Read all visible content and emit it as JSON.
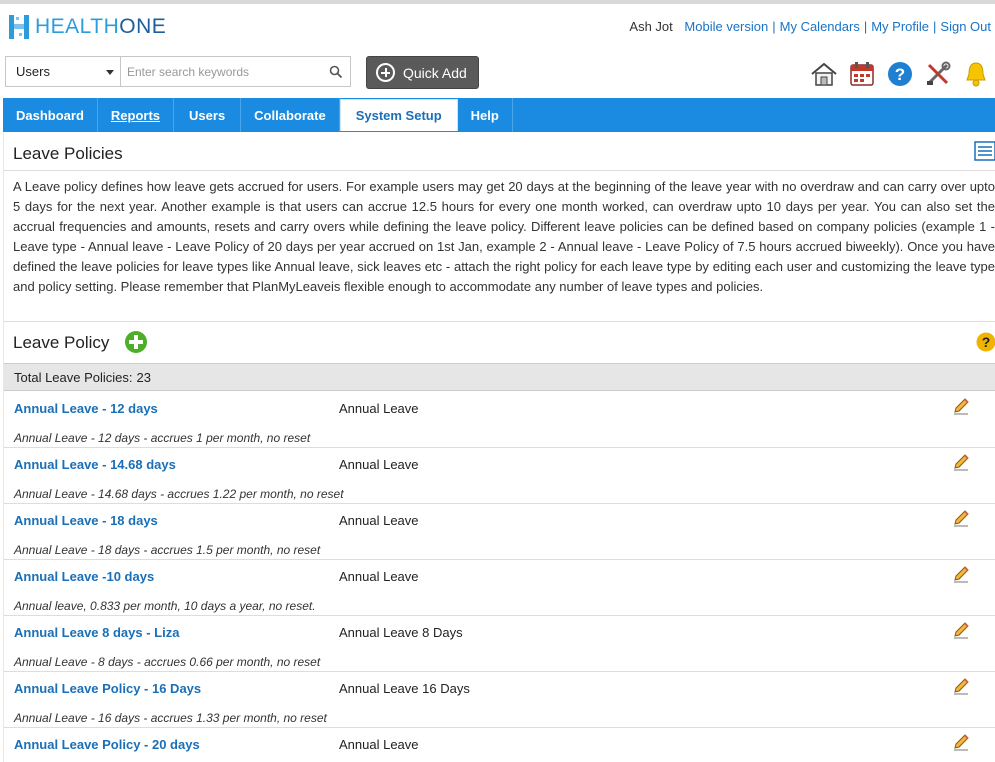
{
  "header": {
    "logo": {
      "part1": "HEALTH",
      "part2": "ONE"
    },
    "user_name": "Ash Jot",
    "links": [
      "Mobile version",
      "My Calendars",
      "My Profile",
      "Sign Out"
    ]
  },
  "search": {
    "category": "Users",
    "placeholder": "Enter search keywords",
    "quick_add_label": "Quick Add"
  },
  "toolbar_icons": [
    "home-icon",
    "calendar-icon",
    "help-icon",
    "settings-tools-icon",
    "notification-bell-icon"
  ],
  "nav": {
    "items": [
      "Dashboard",
      "Reports",
      "Users",
      "Collaborate",
      "System Setup",
      "Help"
    ],
    "active": "System Setup"
  },
  "page": {
    "title": "Leave Policies",
    "description": "A Leave policy defines how leave gets accrued for users. For example users may get 20 days at the beginning of the leave year with no overdraw and can carry over upto 5 days for the next year. Another example is that users can accrue 12.5 hours for every one month worked, can overdraw upto 10 days per year. You can also set the accrual frequencies and amounts, resets and carry overs while defining the leave policy. Different leave policies can be defined based on company policies (example 1 - Leave type - Annual leave - Leave Policy of 20 days per year accrued on 1st Jan, example 2 - Annual leave - Leave Policy of 7.5 hours accrued biweekly). Once you have defined the leave policies for leave types like Annual leave, sick leaves etc - attach the right policy for each leave type by editing each user and customizing the leave type and policy setting. Please remember that PlanMyLeaveis flexible enough to accommodate any number of leave types and policies."
  },
  "policy_section": {
    "title": "Leave Policy",
    "total_label": "Total Leave Policies:",
    "total_count": "23"
  },
  "policies": [
    {
      "name": "Annual Leave - 12 days",
      "type": "Annual Leave",
      "description": "Annual Leave - 12 days - accrues 1 per month, no reset"
    },
    {
      "name": "Annual Leave - 14.68 days",
      "type": "Annual Leave",
      "description": "Annual Leave - 14.68 days - accrues 1.22 per month, no reset"
    },
    {
      "name": "Annual Leave - 18 days",
      "type": "Annual Leave",
      "description": "Annual Leave - 18 days - accrues 1.5 per month, no reset"
    },
    {
      "name": "Annual Leave -10 days",
      "type": "Annual Leave",
      "description": "Annual leave, 0.833 per month, 10 days a year, no reset."
    },
    {
      "name": "Annual Leave 8 days - Liza",
      "type": "Annual Leave 8 Days",
      "description": "Annual Leave - 8 days - accrues 0.66 per month, no reset"
    },
    {
      "name": "Annual Leave Policy - 16 Days",
      "type": "Annual Leave 16 Days",
      "description": "Annual Leave - 16 days - accrues 1.33 per month, no reset"
    },
    {
      "name": "Annual Leave Policy - 20 days",
      "type": "Annual Leave",
      "description": ""
    }
  ],
  "colors": {
    "nav_blue": "#1a8be0",
    "link_blue": "#1a6fb8",
    "add_green": "#4caf27",
    "help_yellow": "#f0b400"
  }
}
